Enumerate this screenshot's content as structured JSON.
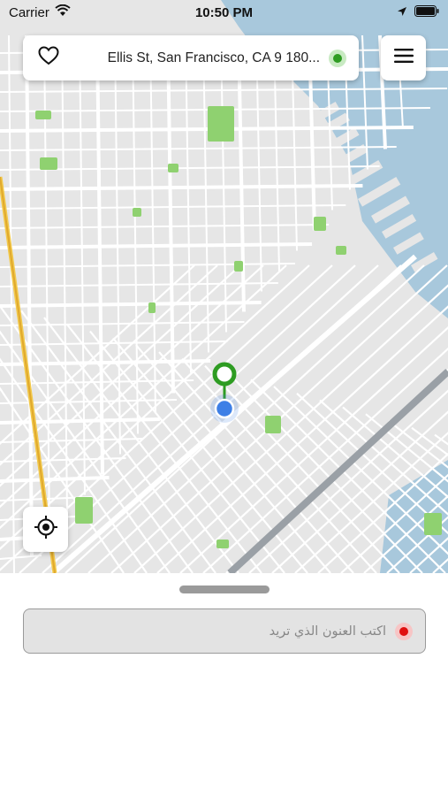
{
  "status_bar": {
    "carrier": "Carrier",
    "time": "10:50 PM",
    "icons": [
      "wifi-icon",
      "location-arrow-icon",
      "battery-icon"
    ]
  },
  "search_bar": {
    "address": "Ellis St, San Francisco, CA 9 180...",
    "favorite_icon": "heart-icon",
    "origin_indicator": "green-dot"
  },
  "menu": {
    "icon": "hamburger-icon"
  },
  "map": {
    "pickup_pin": "green-pin",
    "current_location": "blue-dot",
    "locate_icon": "crosshair-icon"
  },
  "destination": {
    "placeholder": "اكتب العنون الذي تريد",
    "indicator": "red-dot"
  },
  "colors": {
    "accent_green": "#2e9c22",
    "destination_red": "#e01010",
    "location_blue": "#3d7fe6",
    "water": "#a8c8dc",
    "park": "#8fd170"
  }
}
